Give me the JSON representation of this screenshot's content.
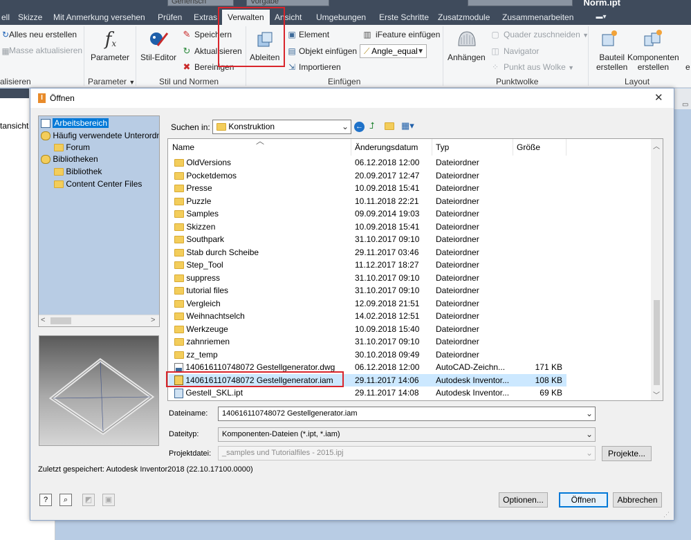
{
  "app": {
    "document_name": "Norm.ipt",
    "style_dd": "Generisch",
    "appearance_dd": "Vorgabe"
  },
  "ribbon_tabs": [
    "ell",
    "Skizze",
    "Mit Anmerkung versehen",
    "Prüfen",
    "Extras",
    "Verwalten",
    "Ansicht",
    "Umgebungen",
    "Erste Schritte",
    "Zusatzmodule",
    "Zusammenarbeiten"
  ],
  "ribbon": {
    "alles_neu": "Alles neu erstellen",
    "masse": "Masse aktualisieren",
    "group_left": "alisieren",
    "parameter": "Parameter",
    "group_parameter": "Parameter",
    "stil_editor": "Stil-Editor",
    "speichern": "Speichern",
    "aktualisieren": "Aktualisieren",
    "bereinigen": "Bereinigen",
    "group_stil": "Stil und Normen",
    "ableiten": "Ableiten",
    "element": "Element",
    "objekt_einfuegen": "Objekt einfügen",
    "importieren": "Importieren",
    "ifeature": "iFeature einfügen",
    "angle_equal": "Angle_equal",
    "group_einfuegen": "Einfügen",
    "anhaengen": "Anhängen",
    "quader": "Quader zuschneiden",
    "navigator": "Navigator",
    "punkt_aus_wolke": "Punkt aus Wolke",
    "group_punktwolke": "Punktwolke",
    "bauteil_1": "Bauteil",
    "bauteil_2": "erstellen",
    "komponenten_1": "Komponenten",
    "komponenten_2": "erstellen",
    "group_layout": "Layout",
    "trailing": "e"
  },
  "left_strip_text": "tansicht",
  "dialog": {
    "title": "Öffnen",
    "close": "✕",
    "tree": [
      "Arbeitsbereich",
      "Häufig verwendete Unterordn",
      "Forum",
      "Bibliotheken",
      "Bibliothek",
      "Content Center Files"
    ],
    "suchen_in_label": "Suchen in:",
    "suchen_in_value": "Konstruktion",
    "columns": {
      "name": "Name",
      "date": "Änderungsdatum",
      "type": "Typ",
      "size": "Größe"
    },
    "files": [
      {
        "name": "OldVersions",
        "date": "06.12.2018 12:00",
        "type": "Dateiordner",
        "size": "",
        "icon": "folder"
      },
      {
        "name": "Pocketdemos",
        "date": "20.09.2017 12:47",
        "type": "Dateiordner",
        "size": "",
        "icon": "folder"
      },
      {
        "name": "Presse",
        "date": "10.09.2018 15:41",
        "type": "Dateiordner",
        "size": "",
        "icon": "folder"
      },
      {
        "name": "Puzzle",
        "date": "10.11.2018 22:21",
        "type": "Dateiordner",
        "size": "",
        "icon": "folder"
      },
      {
        "name": "Samples",
        "date": "09.09.2014 19:03",
        "type": "Dateiordner",
        "size": "",
        "icon": "folder"
      },
      {
        "name": "Skizzen",
        "date": "10.09.2018 15:41",
        "type": "Dateiordner",
        "size": "",
        "icon": "folder"
      },
      {
        "name": "Southpark",
        "date": "31.10.2017 09:10",
        "type": "Dateiordner",
        "size": "",
        "icon": "folder"
      },
      {
        "name": "Stab durch Scheibe",
        "date": "29.11.2017 03:46",
        "type": "Dateiordner",
        "size": "",
        "icon": "folder"
      },
      {
        "name": "Step_Tool",
        "date": "11.12.2017 18:27",
        "type": "Dateiordner",
        "size": "",
        "icon": "folder"
      },
      {
        "name": "suppress",
        "date": "31.10.2017 09:10",
        "type": "Dateiordner",
        "size": "",
        "icon": "folder"
      },
      {
        "name": "tutorial files",
        "date": "31.10.2017 09:10",
        "type": "Dateiordner",
        "size": "",
        "icon": "folder"
      },
      {
        "name": "Vergleich",
        "date": "12.09.2018 21:51",
        "type": "Dateiordner",
        "size": "",
        "icon": "folder"
      },
      {
        "name": "Weihnachtselch",
        "date": "14.02.2018 12:51",
        "type": "Dateiordner",
        "size": "",
        "icon": "folder"
      },
      {
        "name": "Werkzeuge",
        "date": "10.09.2018 15:40",
        "type": "Dateiordner",
        "size": "",
        "icon": "folder"
      },
      {
        "name": "zahnriemen",
        "date": "31.10.2017 09:10",
        "type": "Dateiordner",
        "size": "",
        "icon": "folder"
      },
      {
        "name": "zz_temp",
        "date": "30.10.2018 09:49",
        "type": "Dateiordner",
        "size": "",
        "icon": "folder"
      },
      {
        "name": "140616110748072 Gestellgenerator.dwg",
        "date": "06.12.2018 12:00",
        "type": "AutoCAD-Zeichn...",
        "size": "171 KB",
        "icon": "dwg"
      },
      {
        "name": "140616110748072 Gestellgenerator.iam",
        "date": "29.11.2017 14:06",
        "type": "Autodesk Inventor...",
        "size": "108 KB",
        "icon": "iam",
        "selected": true
      },
      {
        "name": "Gestell_SKL.ipt",
        "date": "29.11.2017 14:08",
        "type": "Autodesk Inventor...",
        "size": "69 KB",
        "icon": "ipt"
      }
    ],
    "dateiname_label": "Dateiname:",
    "dateiname_value": "140616110748072 Gestellgenerator.iam",
    "dateityp_label": "Dateityp:",
    "dateityp_value": "Komponenten-Dateien (*.ipt, *.iam)",
    "projekt_label": "Projektdatei:",
    "projekt_value": "_samples und Tutorialfiles - 2015.ipj",
    "projekte_button": "Projekte...",
    "last_saved": "Zuletzt gespeichert: Autodesk Inventor2018 (22.10.17100.0000)",
    "optionen": "Optionen...",
    "oeffnen": "Öffnen",
    "abbrechen": "Abbrechen"
  },
  "colors": {
    "highlight_red": "#d9252c",
    "selection": "#cce8ff",
    "tree_bg": "#b8cce4",
    "folder": "#f3cd5b"
  }
}
